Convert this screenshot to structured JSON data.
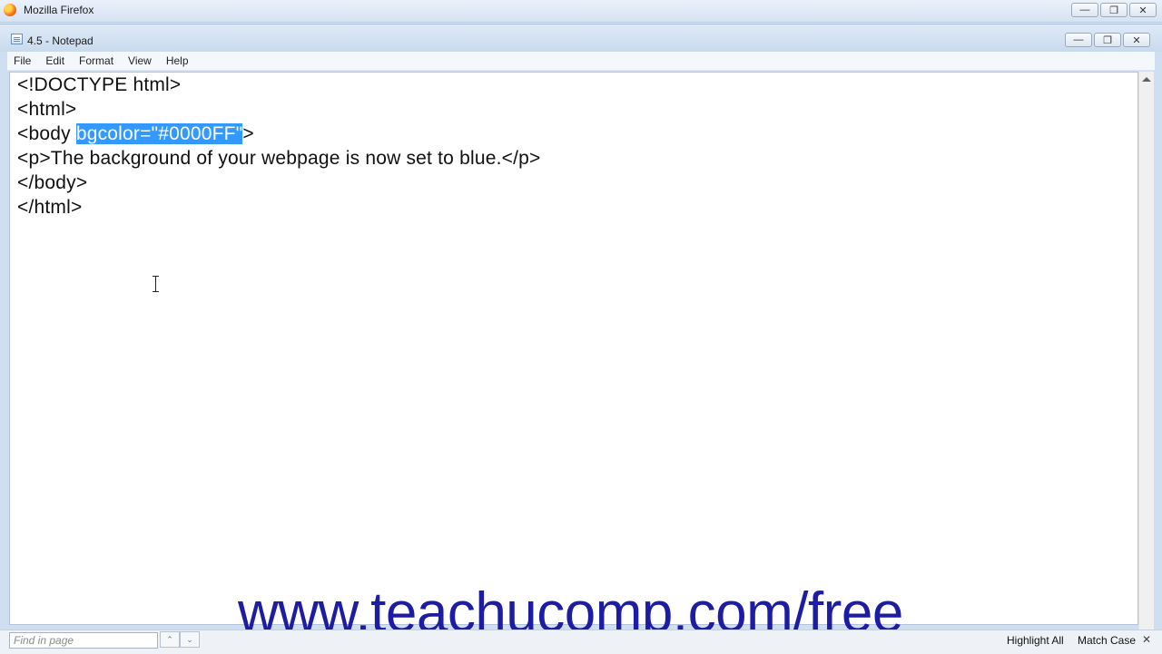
{
  "firefox": {
    "title": "Mozilla Firefox",
    "caption": {
      "minimize": "—",
      "restore": "❐",
      "close": "✕"
    }
  },
  "notepad": {
    "title": "4.5 - Notepad",
    "caption": {
      "minimize": "—",
      "restore": "❐",
      "close": "✕"
    },
    "menu": [
      "File",
      "Edit",
      "Format",
      "View",
      "Help"
    ],
    "lines": [
      {
        "text": "<!DOCTYPE html>"
      },
      {
        "text": "<html>"
      },
      {
        "before": "<body ",
        "selected": "bgcolor=\"#0000FF\"",
        "after": ">"
      },
      {
        "text": "<p>The background of your webpage is now set to blue.</p>"
      },
      {
        "text": "</body>"
      },
      {
        "text": "</html>"
      }
    ]
  },
  "watermark": "www.teachucomp.com/free",
  "findbar": {
    "placeholder": "Find in page",
    "prev": "⌃",
    "next": "⌄",
    "highlight_all": "Highlight All",
    "match_case": "Match Case",
    "close": "✕"
  },
  "colors": {
    "selection": "#3399ff",
    "watermark": "#1d1da3"
  }
}
